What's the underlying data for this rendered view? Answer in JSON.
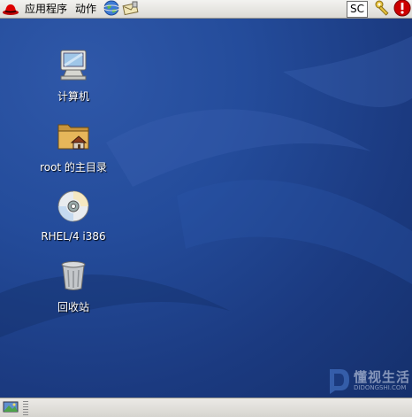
{
  "top_panel": {
    "menus": [
      {
        "label": "应用程序",
        "icon": "redhat-icon"
      },
      {
        "label": "动作"
      }
    ],
    "launchers": [
      "web-browser-icon",
      "mail-icon"
    ],
    "input_method": "SC",
    "tray": [
      "keys-icon",
      "update-alert-icon"
    ]
  },
  "desktop": {
    "icons": [
      {
        "label": "计算机",
        "icon": "computer-icon"
      },
      {
        "label": "root 的主目录",
        "icon": "home-folder-icon"
      },
      {
        "label": "RHEL/4 i386",
        "icon": "cd-disc-icon"
      },
      {
        "label": "回收站",
        "icon": "trash-icon"
      }
    ],
    "watermark": {
      "name": "懂视生活",
      "url": "DIDONGSHI.COM"
    }
  },
  "bottom_panel": {
    "show_desktop": "show-desktop-icon"
  },
  "colors": {
    "desktop_bg": "#244c9b",
    "panel_bg": "#dcdad5",
    "alert": "#cc0000"
  }
}
